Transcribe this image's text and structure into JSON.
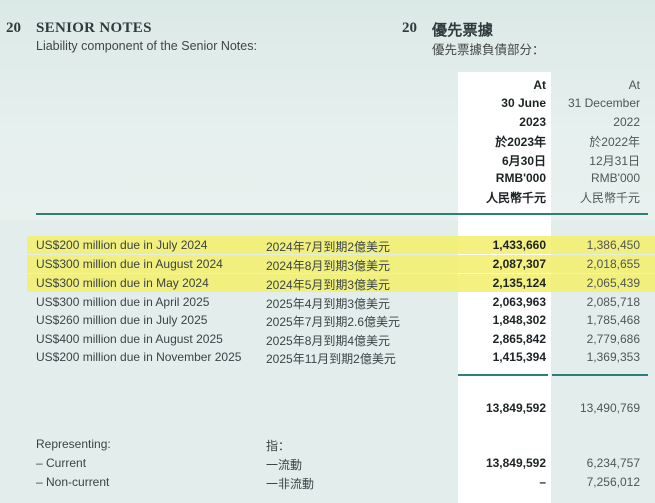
{
  "section": {
    "number_en": "20",
    "title_en": "SENIOR NOTES",
    "subtitle_en": "Liability component of the Senior Notes:",
    "number_cn": "20",
    "title_cn": "優先票據",
    "subtitle_cn": "優先票據負債部分："
  },
  "columns": {
    "current": [
      "At",
      "30 June",
      "2023",
      "於2023年",
      "6月30日",
      "RMB'000",
      "人民幣千元"
    ],
    "prior": [
      "At",
      "31 December",
      "2022",
      "於2022年",
      "12月31日",
      "RMB'000",
      "人民幣千元"
    ]
  },
  "rows": [
    {
      "label_en": "US$200 million due in July 2024",
      "label_cn": "2024年7月到期2億美元",
      "current": "1,433,660",
      "prior": "1,386,450",
      "highlighted": true
    },
    {
      "label_en": "US$300 million due in August 2024",
      "label_cn": "2024年8月到期3億美元",
      "current": "2,087,307",
      "prior": "2,018,655",
      "highlighted": true
    },
    {
      "label_en": "US$300 million due in May 2024",
      "label_cn": "2024年5月到期3億美元",
      "current": "2,135,124",
      "prior": "2,065,439",
      "highlighted": true
    },
    {
      "label_en": "US$300 million due in April 2025",
      "label_cn": "2025年4月到期3億美元",
      "current": "2,063,963",
      "prior": "2,085,718",
      "highlighted": false
    },
    {
      "label_en": "US$260 million due in July 2025",
      "label_cn": "2025年7月到期2.6億美元",
      "current": "1,848,302",
      "prior": "1,785,468",
      "highlighted": false
    },
    {
      "label_en": "US$400 million due in August 2025",
      "label_cn": "2025年8月到期4億美元",
      "current": "2,865,842",
      "prior": "2,779,686",
      "highlighted": false
    },
    {
      "label_en": "US$200 million due in November 2025",
      "label_cn": "2025年11月到期2億美元",
      "current": "1,415,394",
      "prior": "1,369,353",
      "highlighted": false
    }
  ],
  "total": {
    "current": "13,849,592",
    "prior": "13,490,769"
  },
  "representing": {
    "label_en": "Representing:",
    "label_cn": "指：",
    "current_en": "– Current",
    "current_cn": "一流動",
    "current_value": "13,849,592",
    "current_prior": "6,234,757",
    "noncurrent_en": "– Non-current",
    "noncurrent_cn": "一非流動",
    "noncurrent_value": "–",
    "noncurrent_prior": "7,256,012"
  },
  "colors": {
    "highlight": "#f3ee6a",
    "rule": "#2d7f7a",
    "background": "#e3eeec"
  }
}
